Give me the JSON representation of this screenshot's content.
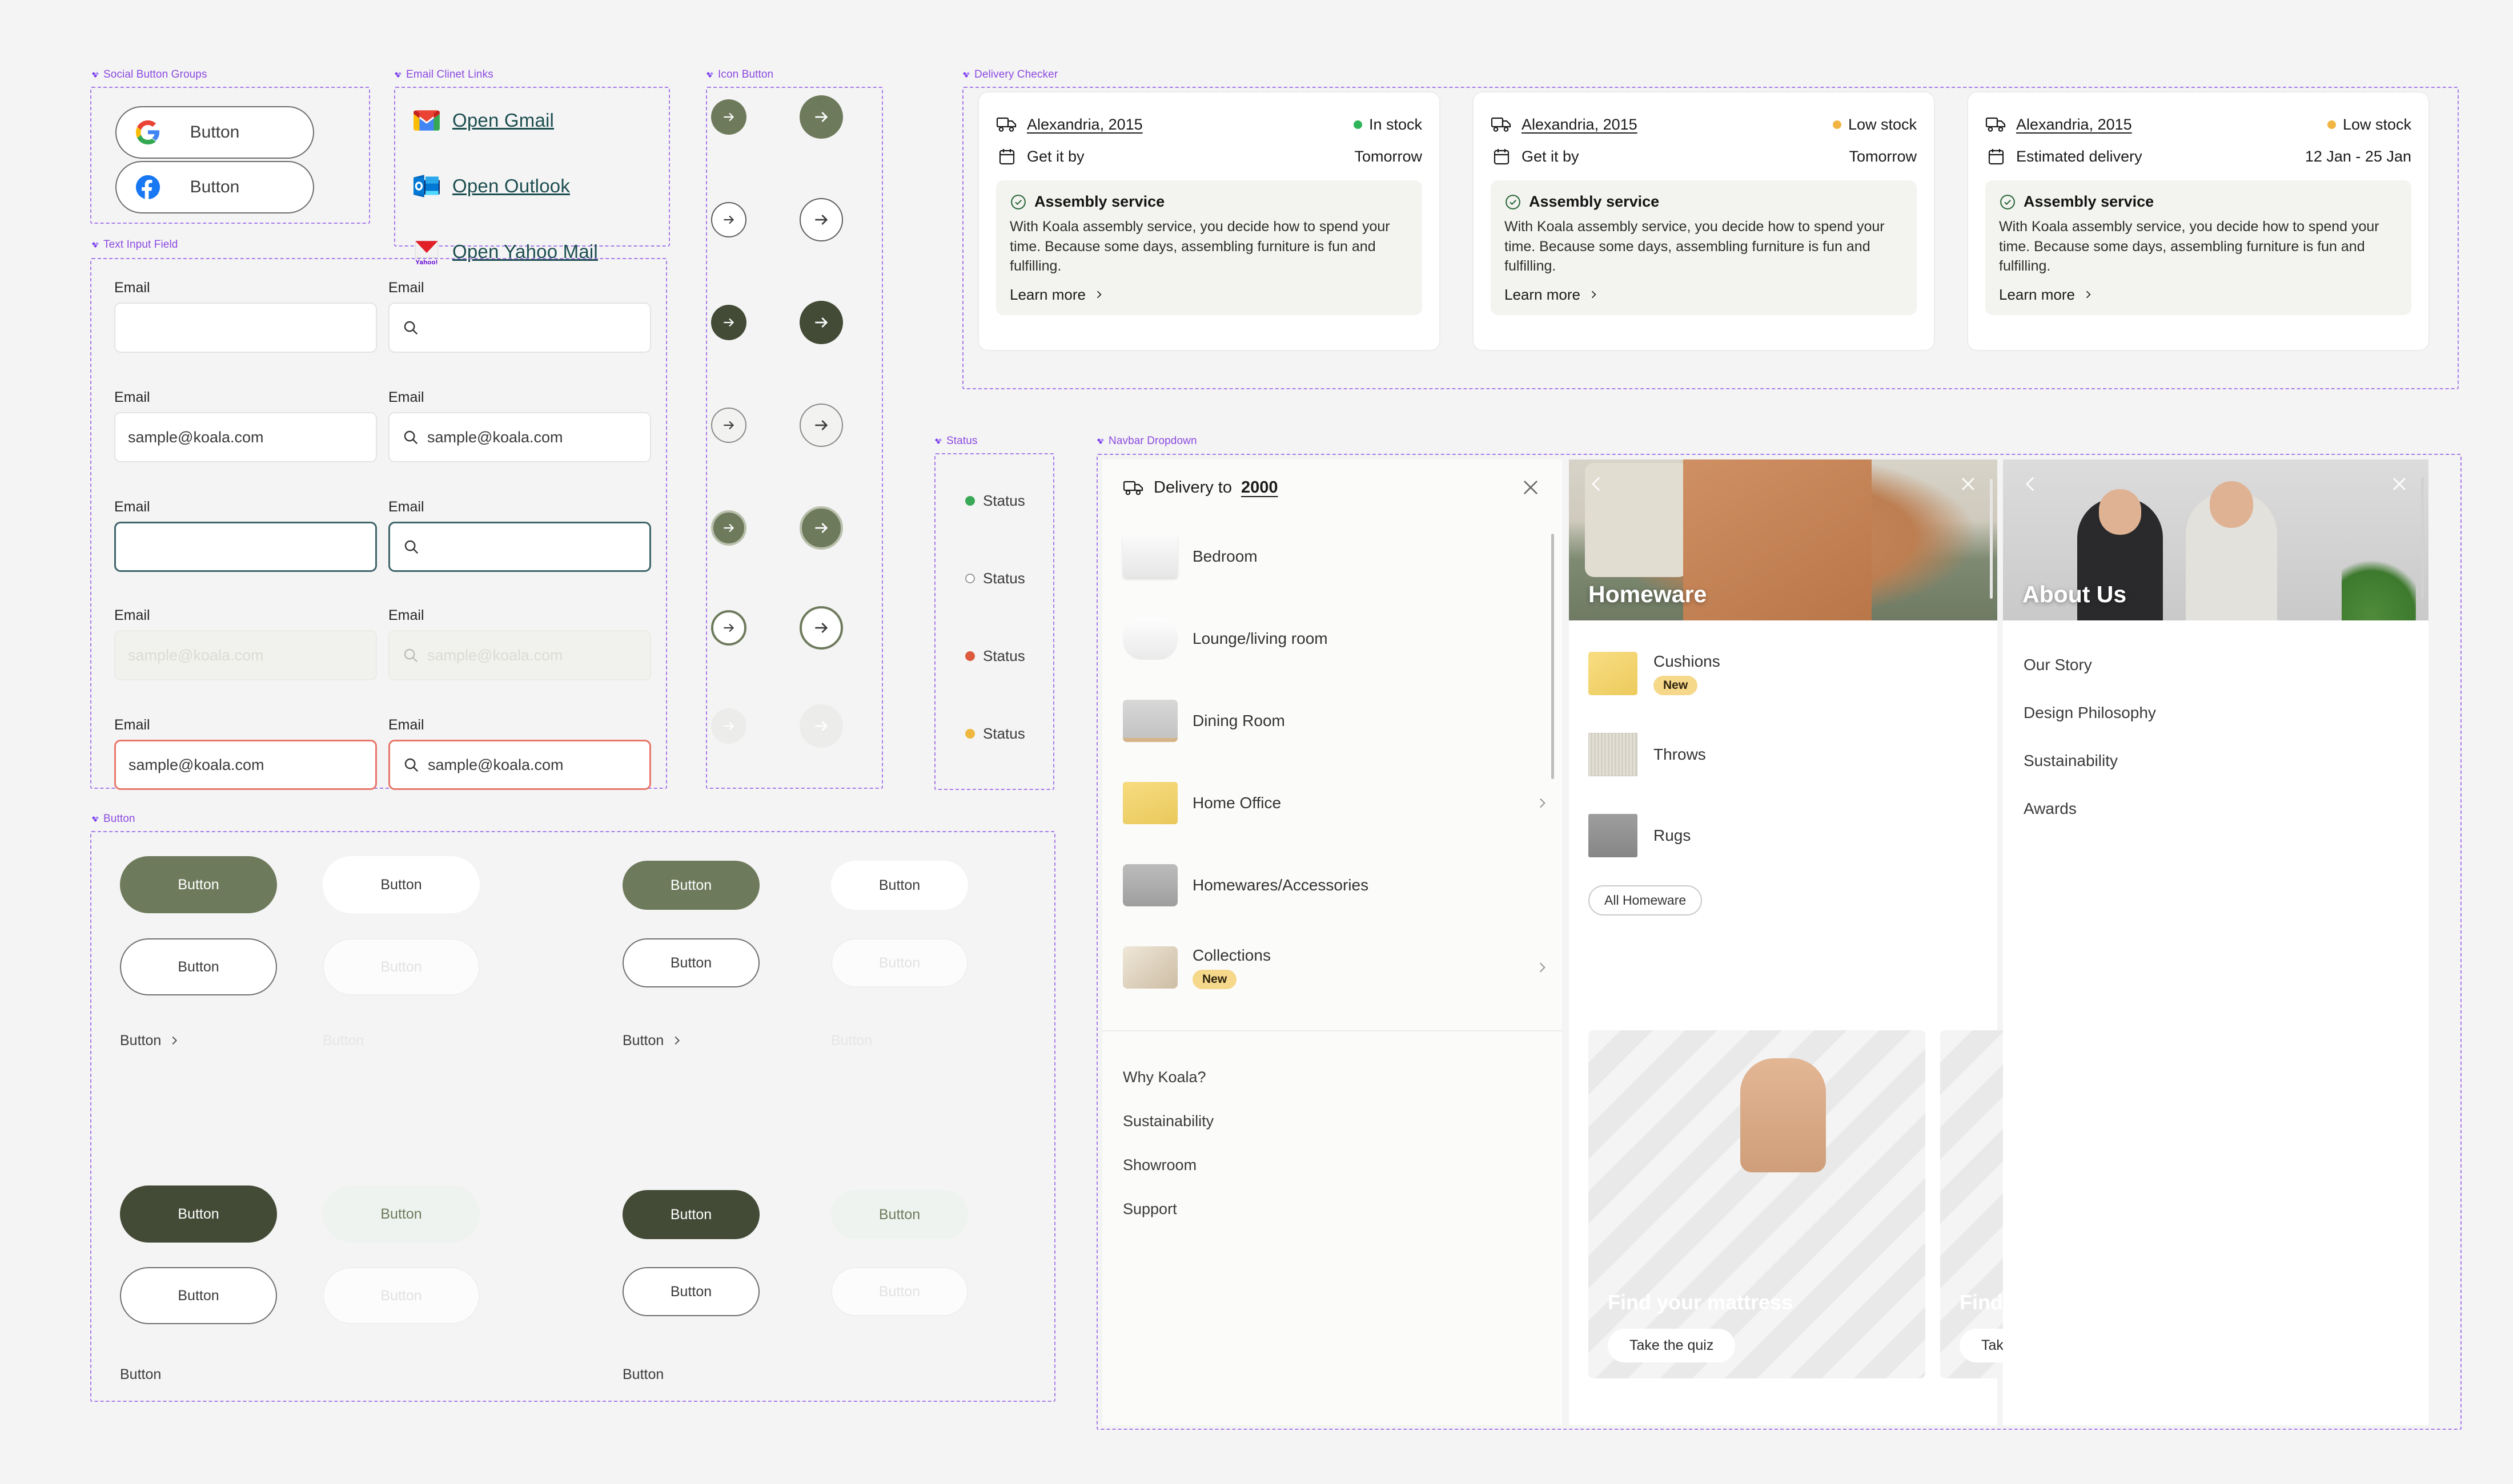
{
  "sections": {
    "social": "Social Button Groups",
    "email_links": "Email Clinet Links",
    "text_input": "Text Input Field",
    "icon_button": "Icon Button",
    "button": "Button",
    "delivery_checker": "Delivery Checker",
    "status": "Status",
    "navbar_dropdown": "Navbar Dropdown"
  },
  "social_buttons": [
    {
      "label": "Button",
      "provider": "google"
    },
    {
      "label": "Button",
      "provider": "facebook"
    }
  ],
  "email_links": [
    {
      "label": "Open Gmail",
      "icon": "gmail-icon"
    },
    {
      "label": "Open Outlook",
      "icon": "outlook-icon"
    },
    {
      "label": "Open Yahoo Mail",
      "icon": "yahoo-icon"
    }
  ],
  "text_fields": [
    {
      "label": "Email",
      "value": "",
      "placeholder": "",
      "state": "default",
      "search": false
    },
    {
      "label": "Email",
      "value": "",
      "placeholder": "",
      "state": "default",
      "search": true
    },
    {
      "label": "Email",
      "value": "sample@koala.com",
      "placeholder": "",
      "state": "filled",
      "search": false
    },
    {
      "label": "Email",
      "value": "sample@koala.com",
      "placeholder": "",
      "state": "filled",
      "search": true
    },
    {
      "label": "Email",
      "value": "",
      "placeholder": "",
      "state": "focus",
      "search": false
    },
    {
      "label": "Email",
      "value": "",
      "placeholder": "",
      "state": "focus",
      "search": true
    },
    {
      "label": "Email",
      "value": "",
      "placeholder": "sample@koala.com",
      "state": "disabled",
      "search": false
    },
    {
      "label": "Email",
      "value": "",
      "placeholder": "sample@koala.com",
      "state": "disabled",
      "search": true
    },
    {
      "label": "Email",
      "value": "sample@koala.com",
      "placeholder": "",
      "state": "error",
      "search": false
    },
    {
      "label": "Email",
      "value": "sample@koala.com",
      "placeholder": "",
      "state": "error",
      "search": true
    }
  ],
  "icon_buttons": [
    {
      "state": "default",
      "fill": "#6e7a5c",
      "arrow": "#ffffff",
      "border": "none"
    },
    {
      "state": "outline",
      "fill": "#ffffff",
      "arrow": "#3c3c3c",
      "border": "#5e5e5e"
    },
    {
      "state": "pressed",
      "fill": "#434a36",
      "arrow": "#ffffff",
      "border": "none"
    },
    {
      "state": "ghost",
      "fill": "#f2f2f0",
      "arrow": "#3c3c3c",
      "border": "#8a8a8a"
    },
    {
      "state": "focus",
      "fill": "#6e7a5c",
      "arrow": "#ffffff",
      "border": "#b9c0ac"
    },
    {
      "state": "focus-outline",
      "fill": "#ffffff",
      "arrow": "#3c3c3c",
      "border": "#6e7a5c"
    },
    {
      "state": "disabled",
      "fill": "#ececea",
      "arrow": "#ffffff",
      "border": "none"
    }
  ],
  "buttons": {
    "label": "Button",
    "chevron_label": "Button",
    "groups": [
      {
        "variant": "primary",
        "state": "default"
      },
      {
        "variant": "secondary",
        "state": "default"
      },
      {
        "variant": "outline",
        "state": "default"
      },
      {
        "variant": "outline",
        "state": "disabled"
      },
      {
        "variant": "text",
        "state": "default",
        "chevron": true
      },
      {
        "variant": "text",
        "state": "disabled",
        "chevron": false
      },
      {
        "variant": "primary",
        "state": "pressed"
      },
      {
        "variant": "secondary",
        "state": "pressed"
      }
    ]
  },
  "delivery_cards": [
    {
      "location": "Alexandria, 2015",
      "stock_label": "In stock",
      "stock_color": "#2fb457",
      "date_label": "Get it by",
      "date_value": "Tomorrow",
      "assembly_title": "Assembly service",
      "assembly_body": "With Koala assembly service, you decide how to spend your time. Because some days, assembling furniture is fun and fulfilling.",
      "learn_more": "Learn more"
    },
    {
      "location": "Alexandria, 2015",
      "stock_label": "Low stock",
      "stock_color": "#f2b544",
      "date_label": "Get it by",
      "date_value": "Tomorrow",
      "assembly_title": "Assembly service",
      "assembly_body": "With Koala assembly service, you decide how to spend your time. Because some days, assembling furniture is fun and fulfilling.",
      "learn_more": "Learn more"
    },
    {
      "location": "Alexandria, 2015",
      "stock_label": "Low stock",
      "stock_color": "#f2b544",
      "date_label": "Estimated delivery",
      "date_value": "12 Jan - 25 Jan",
      "assembly_title": "Assembly service",
      "assembly_body": "With Koala assembly service, you decide how to spend your time. Because some days, assembling furniture is fun and fulfilling.",
      "learn_more": "Learn more"
    }
  ],
  "statuses": [
    {
      "label": "Status",
      "color": "#3aa957"
    },
    {
      "label": "Status",
      "color": "#ffffff"
    },
    {
      "label": "Status",
      "color": "#dd5a3d"
    },
    {
      "label": "Status",
      "color": "#efb73f"
    }
  ],
  "navbar": {
    "delivery_prefix": "Delivery to",
    "delivery_zip": "2000",
    "categories": [
      {
        "label": "Bedroom",
        "chevron": false,
        "badge": ""
      },
      {
        "label": "Lounge/living room",
        "chevron": false,
        "badge": ""
      },
      {
        "label": "Dining Room",
        "chevron": false,
        "badge": ""
      },
      {
        "label": "Home Office",
        "chevron": true,
        "badge": ""
      },
      {
        "label": "Homewares/Accessories",
        "chevron": false,
        "badge": ""
      },
      {
        "label": "Collections",
        "chevron": true,
        "badge": "New"
      }
    ],
    "links": [
      "Why Koala?",
      "Sustainability",
      "Showroom",
      "Support"
    ],
    "homeware": {
      "hero_title": "Homeware",
      "items": [
        {
          "label": "Cushions",
          "badge": "New"
        },
        {
          "label": "Throws",
          "badge": ""
        },
        {
          "label": "Rugs",
          "badge": ""
        }
      ],
      "all_link": "All Homeware",
      "promos": [
        {
          "title": "Find your mattress",
          "cta": "Take the quiz"
        },
        {
          "title": "Find your mattress",
          "cta": "Take the quiz"
        }
      ]
    },
    "about": {
      "hero_title": "About Us",
      "links": [
        "Our Story",
        "Design Philosophy",
        "Sustainability",
        "Awards"
      ]
    }
  }
}
